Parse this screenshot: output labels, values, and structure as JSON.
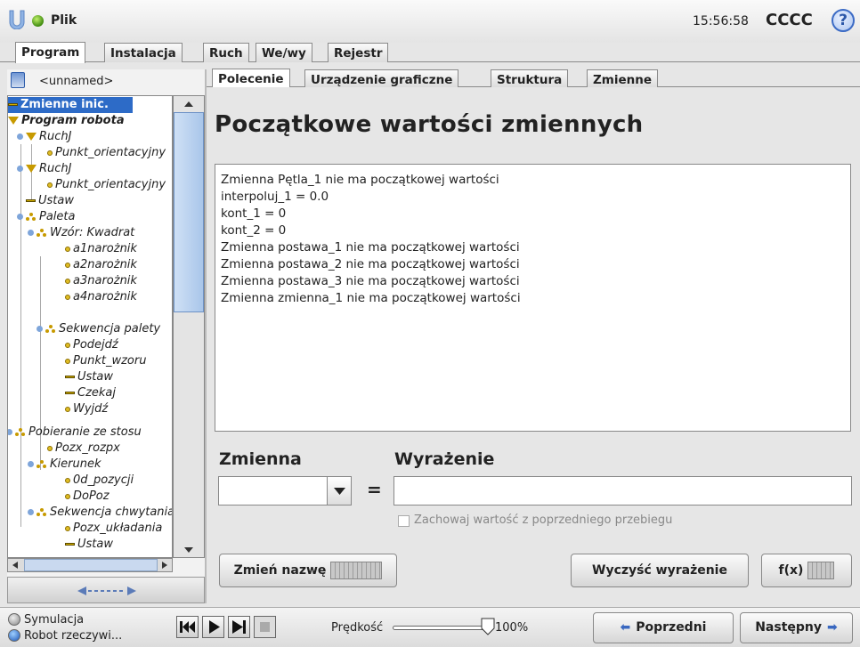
{
  "topbar": {
    "menu_label": "Plik",
    "time": "15:56:58",
    "robot_name": "CCCC",
    "help_label": "?"
  },
  "main_tabs": [
    "Program",
    "Instalacja",
    "Ruch",
    "We/wy",
    "Rejestr"
  ],
  "left": {
    "filename": "<unnamed>",
    "tree": [
      {
        "label": "Zmienne inic.",
        "icon": "variable-icon"
      },
      {
        "label": "Program robota",
        "icon": "collapse-triangle-icon"
      },
      {
        "label": "RuchJ",
        "icon": "collapse-triangle-icon"
      },
      {
        "label": "Punkt_orientacyjny",
        "icon": "waypoint-icon"
      },
      {
        "label": "RuchJ",
        "icon": "collapse-triangle-icon"
      },
      {
        "label": "Punkt_orientacyjny",
        "icon": "waypoint-icon"
      },
      {
        "label": "Ustaw",
        "icon": "set-icon"
      },
      {
        "label": "Paleta",
        "icon": "pallet-icon"
      },
      {
        "label": "Wzór: Kwadrat",
        "icon": "pallet-icon"
      },
      {
        "label": "a1narożnik",
        "icon": "waypoint-icon"
      },
      {
        "label": "a2narożnik",
        "icon": "waypoint-icon"
      },
      {
        "label": "a3narożnik",
        "icon": "waypoint-icon"
      },
      {
        "label": "a4narożnik",
        "icon": "waypoint-icon"
      },
      {
        "label": "Sekwencja palety",
        "icon": "pallet-icon"
      },
      {
        "label": "Podejdź",
        "icon": "waypoint-icon"
      },
      {
        "label": "Punkt_wzoru",
        "icon": "waypoint-icon"
      },
      {
        "label": "Ustaw",
        "icon": "set-icon"
      },
      {
        "label": "Czekaj",
        "icon": "wait-icon"
      },
      {
        "label": "Wyjdź",
        "icon": "waypoint-icon"
      },
      {
        "label": "Pobieranie ze stosu",
        "icon": "pallet-icon"
      },
      {
        "label": "Pozx_rozpx",
        "icon": "waypoint-icon"
      },
      {
        "label": "Kierunek",
        "icon": "pallet-icon"
      },
      {
        "label": "0d_pozycji",
        "icon": "waypoint-icon"
      },
      {
        "label": "DoPoz",
        "icon": "waypoint-icon"
      },
      {
        "label": "Sekwencja chwytania",
        "icon": "pallet-icon"
      },
      {
        "label": "Pozx_układania",
        "icon": "waypoint-icon"
      },
      {
        "label": "Ustaw",
        "icon": "set-icon"
      }
    ]
  },
  "sub_tabs": [
    "Polecenie",
    "Urządzenie graficzne",
    "Struktura",
    "Zmienne"
  ],
  "content": {
    "title": "Początkowe wartości zmiennych",
    "lines": [
      "Zmienna Pętla_1 nie ma początkowej wartości",
      "interpoluj_1 = 0.0",
      "kont_1 = 0",
      "kont_2 = 0",
      "Zmienna postawa_1 nie ma początkowej wartości",
      "Zmienna postawa_2 nie ma początkowej wartości",
      "Zmienna postawa_3 nie ma początkowej wartości",
      "Zmienna zmienna_1 nie ma początkowej wartości"
    ],
    "variable_label": "Zmienna",
    "expression_label": "Wyrażenie",
    "equals": "=",
    "keep_value_label": "Zachowaj wartość z poprzedniego przebiegu",
    "rename_button": "Zmień nazwę",
    "clear_button": "Wyczyść wyrażenie",
    "fx_button": "f(x)"
  },
  "bottom": {
    "simulation_label": "Symulacja",
    "real_robot_label": "Robot rzeczywi...",
    "speed_label": "Prędkość",
    "speed_value": "100%",
    "speed_fraction": 1.0,
    "prev_button": "Poprzedni",
    "next_button": "Następny"
  },
  "colors": {
    "accent": "#2d6bc7",
    "selected_text": "#ffffff"
  }
}
